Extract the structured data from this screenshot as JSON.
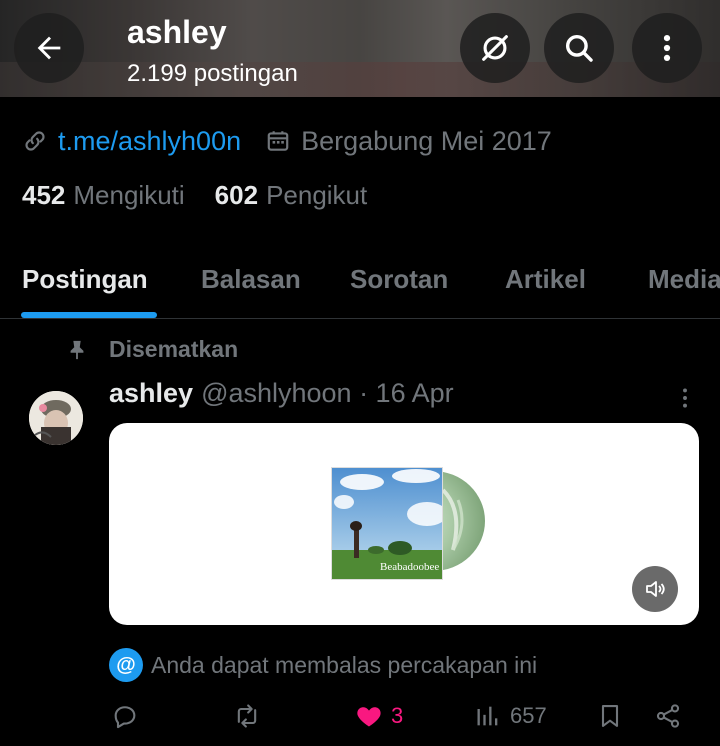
{
  "header": {
    "title": "ashley",
    "subtitle": "2.199 postingan",
    "icons": [
      "back-arrow-icon",
      "grok-icon",
      "search-icon",
      "more-vertical-icon"
    ]
  },
  "profile": {
    "link": "t.me/ashlyh00n",
    "joined": "Bergabung Mei 2017",
    "following_count": "452",
    "following_label": "Mengikuti",
    "followers_count": "602",
    "followers_label": "Pengikut"
  },
  "tabs": [
    {
      "label": "Postingan",
      "active": true
    },
    {
      "label": "Balasan",
      "active": false
    },
    {
      "label": "Sorotan",
      "active": false
    },
    {
      "label": "Artikel",
      "active": false
    },
    {
      "label": "Media",
      "active": false
    }
  ],
  "post": {
    "pinned_label": "Disematkan",
    "author_name": "ashley",
    "author_handle": "@ashlyhoon · 16 Apr",
    "album_text": "Beabadoobee",
    "reply_note": "Anda dapat membalas percakapan ini",
    "actions": {
      "reply": "",
      "repost": "",
      "likes": "3",
      "views": "657"
    }
  },
  "colors": {
    "accent": "#1d9bf0",
    "like": "#f91880",
    "muted": "#71767b",
    "text": "#e7e9ea",
    "background": "#000000"
  }
}
